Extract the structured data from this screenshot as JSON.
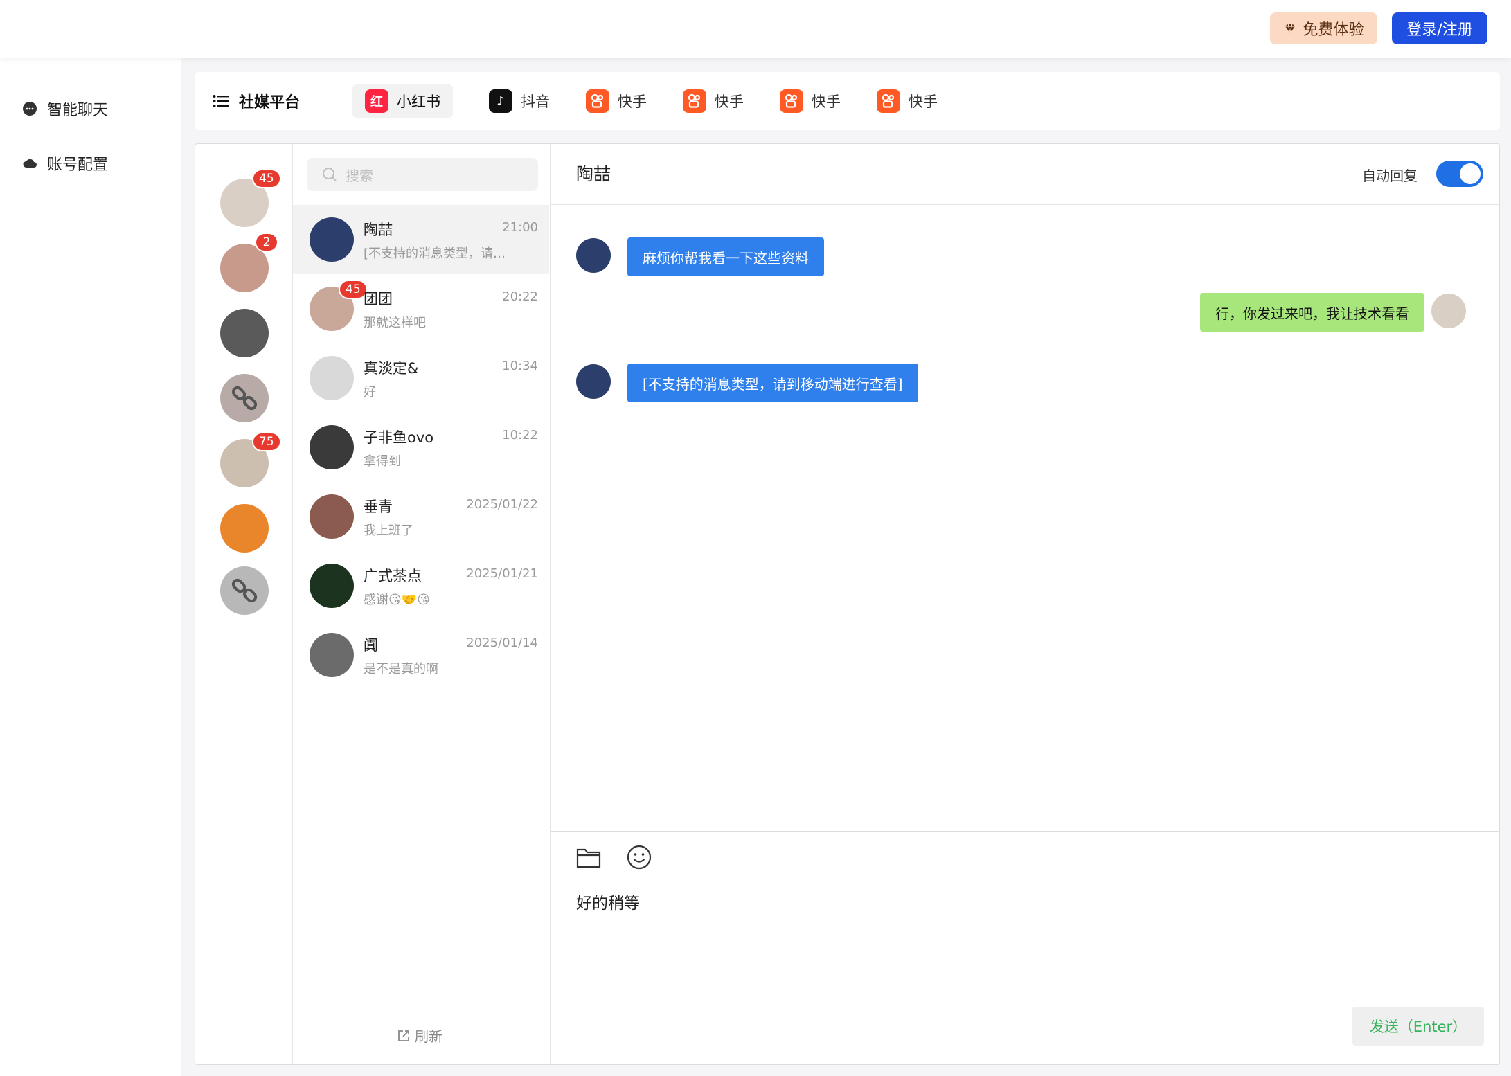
{
  "header": {
    "free_trial_label": "免费体验",
    "login_label": "登录/注册",
    "free_trial_icon": "diamond-icon"
  },
  "sidebar": {
    "items": [
      {
        "label": "智能聊天",
        "icon": "chat-bubble-icon"
      },
      {
        "label": "账号配置",
        "icon": "cloud-icon"
      }
    ]
  },
  "platforms": {
    "title": "社媒平台",
    "title_icon": "list-icon",
    "tabs": [
      {
        "label": "小红书",
        "logo": "红",
        "active": true
      },
      {
        "label": "抖音",
        "logo": "♪",
        "active": false
      },
      {
        "label": "快手",
        "logo": "ks",
        "active": false
      },
      {
        "label": "快手",
        "logo": "ks",
        "active": false
      },
      {
        "label": "快手",
        "logo": "ks",
        "active": false
      },
      {
        "label": "快手",
        "logo": "ks",
        "active": false
      }
    ]
  },
  "accounts": [
    {
      "badge": "45",
      "color": "#d9cfc4"
    },
    {
      "badge": "2",
      "color": "#c89a8c"
    },
    {
      "badge": "",
      "color": "#5a5a5a"
    },
    {
      "badge": "",
      "color": "#b8aaa7"
    },
    {
      "badge": "75",
      "color": "#cdbfb0"
    },
    {
      "badge": "",
      "color": "#e9862c"
    },
    {
      "badge": "",
      "color": "#b8b8b8"
    }
  ],
  "search": {
    "placeholder": "搜索"
  },
  "conversations": [
    {
      "name": "陶喆",
      "preview": "[不支持的消息类型，请到移动端进行查看]",
      "time": "21:00",
      "badge": "",
      "color": "#2c3e6b"
    },
    {
      "name": "团团",
      "preview": "那就这样吧",
      "time": "20:22",
      "badge": "45",
      "color": "#c9a89a"
    },
    {
      "name": "真淡定&",
      "preview": "好",
      "time": "10:34",
      "badge": "",
      "color": "#d9d9d9"
    },
    {
      "name": "子非鱼ovo",
      "preview": "拿得到",
      "time": "10:22",
      "badge": "",
      "color": "#3a3a3a"
    },
    {
      "name": "垂青",
      "preview": "我上班了",
      "time": "2025/01/22",
      "badge": "",
      "color": "#8a5b4e"
    },
    {
      "name": "广式茶点",
      "preview": "感谢😘🤝😘",
      "time": "2025/01/21",
      "badge": "",
      "color": "#1c3320"
    },
    {
      "name": "阗",
      "preview": "是不是真的啊",
      "time": "2025/01/14",
      "badge": "",
      "color": "#6b6b6b"
    }
  ],
  "refresh_label": "刷新",
  "chat": {
    "contact_name": "陶喆",
    "auto_reply_label": "自动回复",
    "auto_reply_on": true,
    "messages": [
      {
        "direction": "in",
        "text": "麻烦你帮我看一下这些资料"
      },
      {
        "direction": "out",
        "text": "行，你发过来吧，我让技术看看"
      },
      {
        "direction": "in",
        "text": "[不支持的消息类型，请到移动端进行查看]"
      }
    ],
    "draft": "好的稍等",
    "send_label": "发送（Enter）",
    "toolbar_icons": [
      "folder-icon",
      "emoji-icon"
    ]
  }
}
